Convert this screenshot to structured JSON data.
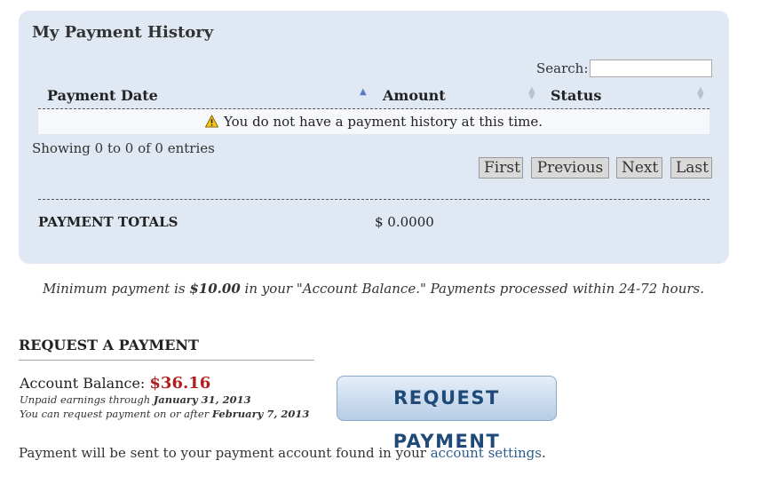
{
  "history": {
    "title": "My Payment History",
    "search_label": "Search:",
    "search_value": "",
    "columns": [
      "Payment Date",
      "Amount",
      "Status"
    ],
    "empty_message": "You do not have a payment history at this time.",
    "info": "Showing 0 to 0 of 0 entries",
    "pagination": [
      "First",
      "Previous",
      "Next",
      "Last"
    ],
    "totals_label": "PAYMENT TOTALS",
    "totals_value": "$ 0.0000"
  },
  "notice": {
    "before": "Minimum payment is ",
    "amount": "$10.00",
    "after": " in your \"Account Balance.\" Payments processed within 24-72 hours."
  },
  "request": {
    "title": "REQUEST A PAYMENT",
    "balance_label": "Account Balance: ",
    "balance_value": "$36.16",
    "unpaid_prefix": "Unpaid earnings through ",
    "unpaid_date": "January 31, 2013",
    "request_prefix": "You can request payment on or after ",
    "request_date": "February 7, 2013",
    "button_label": "REQUEST PAYMENT"
  },
  "footer": {
    "text": "Payment will be sent to your payment account found in your ",
    "link": "account settings",
    "end": "."
  },
  "colors": {
    "panel_bg": "#dfe8f3",
    "balance_red": "#b21e1e",
    "link_blue": "#2a5d8f",
    "button_text": "#1f4a78"
  }
}
